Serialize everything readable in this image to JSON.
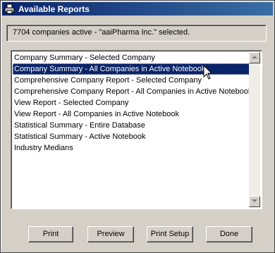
{
  "window": {
    "title": "Available Reports",
    "icon": "printer-icon"
  },
  "status": {
    "text": "7704 companies active - \"aaiPharma Inc.\" selected."
  },
  "reports": [
    {
      "label": "Company Summary - Selected Company",
      "selected": false
    },
    {
      "label": "Company Summary - All Companies in Active Notebook",
      "selected": true
    },
    {
      "label": "Comprehensive Company Report - Selected Company",
      "selected": false
    },
    {
      "label": "Comprehensive Company Report - All Companies in Active Notebook",
      "selected": false
    },
    {
      "label": "View Report - Selected Company",
      "selected": false
    },
    {
      "label": "View Report - All Companies in Active Notebook",
      "selected": false
    },
    {
      "label": "Statistical Summary - Entire Database",
      "selected": false
    },
    {
      "label": "Statistical Summary - Active Notebook",
      "selected": false
    },
    {
      "label": "Industry Medians",
      "selected": false
    }
  ],
  "buttons": {
    "print": "Print",
    "preview": "Preview",
    "print_setup": "Print Setup",
    "done": "Done"
  },
  "colors": {
    "titlebar_start": "#0a246a",
    "titlebar_end": "#3a6ea5",
    "selection": "#0a246a",
    "face": "#d4d0c8"
  }
}
